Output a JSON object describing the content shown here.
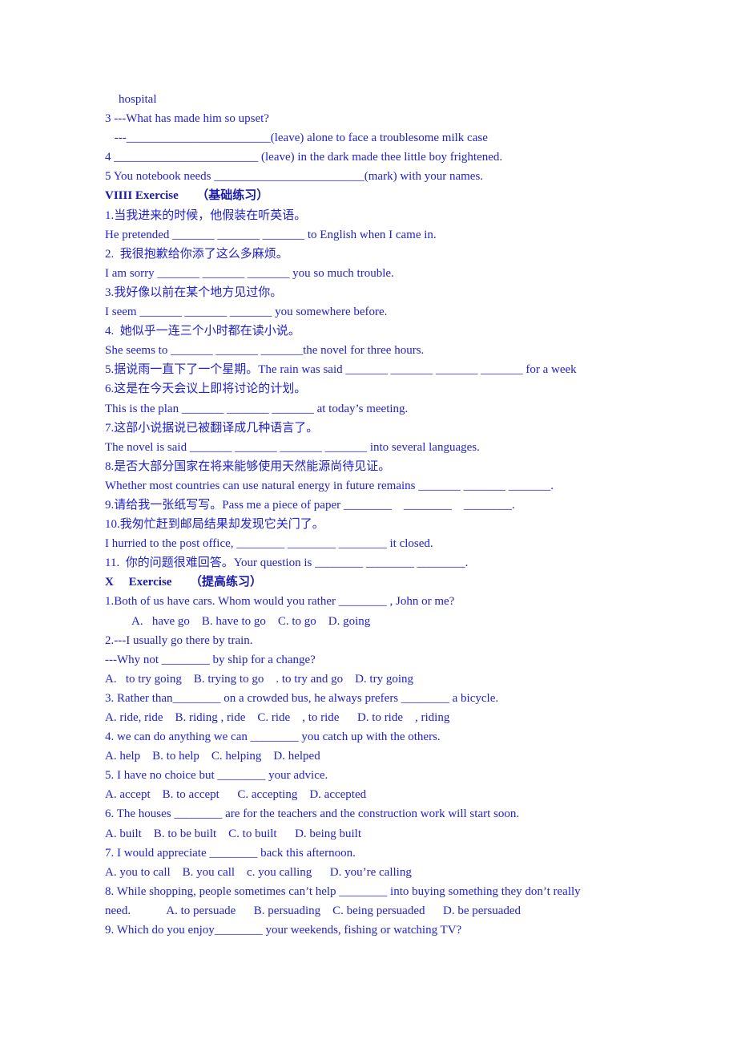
{
  "document": {
    "lines": [
      {
        "id": "l01",
        "text": "hospital",
        "style": "indent-sm"
      },
      {
        "id": "l02",
        "text": "3 ---What has made him so upset?"
      },
      {
        "id": "l03",
        "text": " ---________________________(leave) alone to face a troublesome milk case",
        "style": "indent-xs"
      },
      {
        "id": "l04",
        "text": "4 ________________________ (leave) in the dark made thee little boy frightened."
      },
      {
        "id": "l05",
        "text": "5 You notebook needs _________________________(mark) with your names."
      },
      {
        "id": "l06",
        "text": "VIIII Exercise      （基础练习）",
        "style": "heading"
      },
      {
        "id": "l07",
        "text": "1.当我进来的时候，他假装在听英语。"
      },
      {
        "id": "l08",
        "text": "He pretended _______ _______ _______ to English when I came in."
      },
      {
        "id": "l09",
        "text": "2.  我很抱歉给你添了这么多麻烦。"
      },
      {
        "id": "l10",
        "text": "I am sorry _______ _______ _______ you so much trouble."
      },
      {
        "id": "l11",
        "text": "3.我好像以前在某个地方见过你。"
      },
      {
        "id": "l12",
        "text": "I seem _______ _______ _______ you somewhere before."
      },
      {
        "id": "l13",
        "text": "4.  她似乎一连三个小时都在读小说。"
      },
      {
        "id": "l14",
        "text": "She seems to _______ _______ _______the novel for three hours."
      },
      {
        "id": "l15",
        "text": "5.据说雨一直下了一个星期。The rain was said _______ _______ _______ _______ for a week"
      },
      {
        "id": "l16",
        "text": "6.这是在今天会议上即将讨论的计划。"
      },
      {
        "id": "l17",
        "text": "This is the plan _______ _______ _______ at today’s meeting."
      },
      {
        "id": "l18",
        "text": "7.这部小说据说已被翻译成几种语言了。"
      },
      {
        "id": "l19",
        "text": "The novel is said _______ _______ _______ _______ into several languages."
      },
      {
        "id": "l20",
        "text": "8.是否大部分国家在将来能够使用天然能源尚待见证。"
      },
      {
        "id": "l21",
        "text": "Whether most countries can use natural energy in future remains _______ _______ _______."
      },
      {
        "id": "l22",
        "text": "9.请给我一张纸写写。Pass me a piece of paper ________    ________    ________."
      },
      {
        "id": "l23",
        "text": "10.我匆忙赶到邮局结果却发现它关门了。"
      },
      {
        "id": "l24",
        "text": "I hurried to the post office, ________ ________ ________ it closed."
      },
      {
        "id": "l25",
        "text": "11.  你的问题很难回答。Your question is ________ ________ ________."
      },
      {
        "id": "l26",
        "text": "X     Exercise      （提高练习）",
        "style": "heading"
      },
      {
        "id": "l27",
        "text": "1.Both of us have cars. Whom would you rather ________ , John or me?"
      },
      {
        "id": "l28",
        "text": "A.   have go    B. have to go    C. to go    D. going",
        "style": "indent-opt"
      },
      {
        "id": "l29",
        "text": "2.---I usually go there by train."
      },
      {
        "id": "l30",
        "text": "---Why not ________ by ship for a change?"
      },
      {
        "id": "l31",
        "text": "A.   to try going    B. trying to go    . to try and go    D. try going"
      },
      {
        "id": "l32",
        "text": "3. Rather than________ on a crowded bus, he always prefers ________ a bicycle."
      },
      {
        "id": "l33",
        "text": "A. ride, ride    B. riding , ride    C. ride    , to ride      D. to ride    , riding"
      },
      {
        "id": "l34",
        "text": "4. we can do anything we can ________ you catch up with the others."
      },
      {
        "id": "l35",
        "text": "A. help    B. to help    C. helping    D. helped"
      },
      {
        "id": "l36",
        "text": "5. I have no choice but ________ your advice."
      },
      {
        "id": "l37",
        "text": "A. accept    B. to accept      C. accepting    D. accepted"
      },
      {
        "id": "l38",
        "text": "6. The houses ________ are for the teachers and the construction work will start soon."
      },
      {
        "id": "l39",
        "text": "A. built    B. to be built    C. to built      D. being built"
      },
      {
        "id": "l40",
        "text": "7. I would appreciate ________ back this afternoon."
      },
      {
        "id": "l41",
        "text": "A. you to call    B. you call    c. you calling      D. you’re calling"
      },
      {
        "id": "l42",
        "text": "8. While shopping, people sometimes can’t help ________ into buying something they don’t really"
      },
      {
        "id": "l43",
        "text": "need.            A. to persuade      B. persuading    C. being persuaded      D. be persuaded"
      },
      {
        "id": "l44",
        "text": "9. Which do you enjoy________ your weekends, fishing or watching TV?"
      }
    ]
  },
  "colors": {
    "text": "#2222cc",
    "heading": "#1a1aa8",
    "background": "#ffffff"
  }
}
